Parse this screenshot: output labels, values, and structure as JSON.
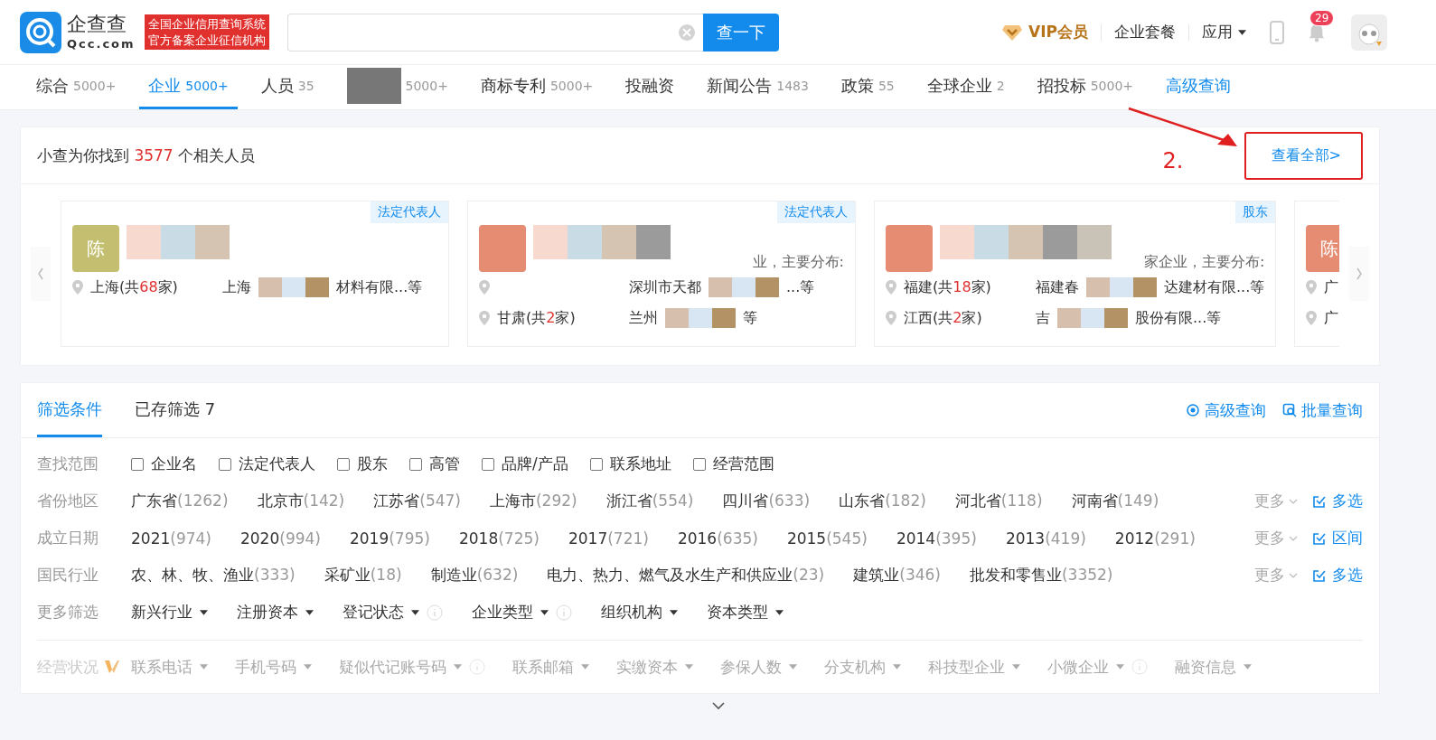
{
  "header": {
    "logo_name": "企查查",
    "logo_domain": "Qcc.com",
    "slogan_lines": [
      "全国企业信用查询系统",
      "官方备案企业征信机构"
    ],
    "search_button": "查一下",
    "vip": "VIP会员",
    "links": [
      {
        "label": "企业套餐",
        "kind": "link"
      },
      {
        "label": "应用",
        "kind": "dropdown"
      }
    ],
    "notification_count": "29"
  },
  "nav_tabs": [
    {
      "label": "综合",
      "count": "5000+",
      "selected": false
    },
    {
      "label": "企业",
      "count": "5000+",
      "selected": true
    },
    {
      "label": "人员",
      "count": "35",
      "selected": false
    },
    {
      "count": "5000+",
      "selected": false
    },
    {
      "label": "商标专利",
      "count": "5000+",
      "selected": false
    },
    {
      "label": "投融资",
      "selected": false
    },
    {
      "label": "新闻公告",
      "count": "1483",
      "selected": false
    },
    {
      "label": "政策",
      "count": "55",
      "selected": false
    },
    {
      "label": "全球企业",
      "count": "2",
      "selected": false
    },
    {
      "label": "招投标",
      "count": "5000+",
      "selected": false
    },
    {
      "label": "高级查询",
      "selected": false,
      "kind": "link"
    }
  ],
  "people_summary": {
    "text": "小查为你找到 **3577** 个相关人员",
    "view_all": "查看全部>",
    "annotation": "2."
  },
  "people_cards": [
    {
      "role": "法定代表人",
      "avatar": "陈",
      "color": "#c4bf70",
      "locations": [
        {
          "region": "上海(共**68**家)",
          "company_start": "上海",
          "company_end": "材料有限...等"
        }
      ]
    },
    {
      "role": "法定代表人",
      "color": "#e58c72",
      "summary": "业，主要分布:",
      "locations": [
        {
          "company_start": "深圳市天都",
          "company_end": "...等"
        },
        {
          "region": "甘肃(共**2**家)",
          "company_start": "兰州",
          "company_end": "等"
        }
      ]
    },
    {
      "role": "股东",
      "color": "#e58c72",
      "summary": "家企业，主要分布:",
      "locations": [
        {
          "region": "福建(共**18**家)",
          "company_start": "福建春",
          "company_end": "达建材有限...等"
        },
        {
          "region": "江西(共**2**家)",
          "company_start": "吉",
          "company_end": "股份有限...等"
        }
      ]
    },
    {
      "avatar": "陈",
      "color": "#e58c72",
      "locations": [
        {
          "region": "广"
        },
        {
          "region": "广"
        }
      ]
    }
  ],
  "filter": {
    "tabs": [
      {
        "label": "筛选条件",
        "selected": true
      },
      {
        "label": "已存筛选 7",
        "selected": false
      }
    ],
    "actions": [
      "高级查询",
      "批量查询"
    ],
    "scope": {
      "label": "查找范围",
      "options": [
        {
          "label": "企业名",
          "checked": false
        },
        {
          "label": "法定代表人",
          "checked": false
        },
        {
          "label": "股东",
          "checked": false
        },
        {
          "label": "高管",
          "checked": false
        },
        {
          "label": "品牌/产品",
          "checked": false
        },
        {
          "label": "联系地址",
          "checked": false
        },
        {
          "label": "经营范围",
          "checked": false
        }
      ]
    },
    "rows": [
      {
        "label": "省份地区",
        "options": [
          [
            "广东省",
            "(1262)"
          ],
          [
            "北京市",
            "(142)"
          ],
          [
            "江苏省",
            "(547)"
          ],
          [
            "上海市",
            "(292)"
          ],
          [
            "浙江省",
            "(554)"
          ],
          [
            "四川省",
            "(633)"
          ],
          [
            "山东省",
            "(182)"
          ],
          [
            "河北省",
            "(118)"
          ],
          [
            "河南省",
            "(149)"
          ]
        ],
        "more": "更多",
        "action": "多选"
      },
      {
        "label": "成立日期",
        "options": [
          [
            "2021",
            "(974)"
          ],
          [
            "2020",
            "(994)"
          ],
          [
            "2019",
            "(795)"
          ],
          [
            "2018",
            "(725)"
          ],
          [
            "2017",
            "(721)"
          ],
          [
            "2016",
            "(635)"
          ],
          [
            "2015",
            "(545)"
          ],
          [
            "2014",
            "(395)"
          ],
          [
            "2013",
            "(419)"
          ],
          [
            "2012",
            "(291)"
          ]
        ],
        "more": "更多",
        "action": "区间"
      },
      {
        "label": "国民行业",
        "options": [
          [
            "农、林、牧、渔业",
            "(333)"
          ],
          [
            "采矿业",
            "(18)"
          ],
          [
            "制造业",
            "(632)"
          ],
          [
            "电力、热力、燃气及水生产和供应业",
            "(23)"
          ],
          [
            "建筑业",
            "(346)"
          ],
          [
            "批发和零售业",
            "(3352)"
          ]
        ],
        "more": "更多",
        "action": "多选"
      }
    ],
    "more_filters": {
      "label": "更多筛选",
      "items": [
        {
          "label": "新兴行业",
          "info": false
        },
        {
          "label": "注册资本",
          "info": false
        },
        {
          "label": "登记状态",
          "info": true
        },
        {
          "label": "企业类型",
          "info": true
        },
        {
          "label": "组织机构",
          "info": false
        },
        {
          "label": "资本类型",
          "info": false
        }
      ]
    },
    "vip_filters": {
      "label": "经营状况",
      "disabled": true,
      "items": [
        {
          "label": "联系电话",
          "info": false
        },
        {
          "label": "手机号码",
          "info": false
        },
        {
          "label": "疑似代记账号码",
          "info": true
        },
        {
          "label": "联系邮箱",
          "info": false
        },
        {
          "label": "实缴资本",
          "info": false
        },
        {
          "label": "参保人数",
          "info": false
        },
        {
          "label": "分支机构",
          "info": false
        },
        {
          "label": "科技型企业",
          "info": false
        },
        {
          "label": "小微企业",
          "info": true
        },
        {
          "label": "融资信息",
          "info": false
        }
      ]
    }
  }
}
